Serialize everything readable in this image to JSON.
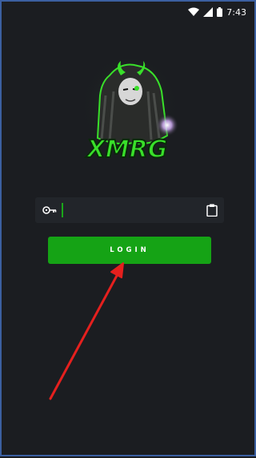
{
  "status_bar": {
    "time": "7:43",
    "icons": [
      "wifi-icon",
      "signal-icon",
      "battery-icon"
    ]
  },
  "logo": {
    "text": "XMRG",
    "accent_color": "#39e02a"
  },
  "key_field": {
    "value": "",
    "placeholder": "",
    "icon": "key-icon",
    "action_icon": "clipboard-icon"
  },
  "login_button": {
    "label": "LOGIN",
    "color": "#15a315"
  },
  "annotation": {
    "arrow_color": "#e5201e"
  }
}
